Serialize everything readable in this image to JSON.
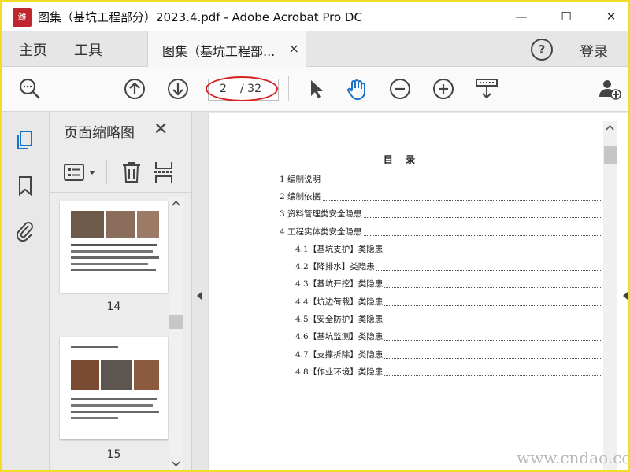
{
  "window": {
    "title": "图集（基坑工程部分）2023.4.pdf - Adobe Acrobat Pro DC",
    "logo_text": "潍",
    "minimize": "—",
    "maximize": "☐",
    "close": "✕"
  },
  "menubar": {
    "home": "主页",
    "tools": "工具",
    "doc_tab": "图集（基坑工程部...",
    "doc_tab_close": "×",
    "help": "?",
    "login": "登录"
  },
  "toolbar": {
    "current_page": "2",
    "total_pages": "/ 32"
  },
  "thumbnail_panel": {
    "title": "页面缩略图",
    "close": "✕",
    "pages": [
      {
        "label": "14"
      },
      {
        "label": "15"
      }
    ]
  },
  "document": {
    "toc_title": "目 录",
    "toc": [
      {
        "text": "1 编制说明",
        "level": 1
      },
      {
        "text": "2 编制依据",
        "level": 1
      },
      {
        "text": "3 资料管理类安全隐患",
        "level": 1
      },
      {
        "text": "4 工程实体类安全隐患",
        "level": 1
      },
      {
        "text": "4.1【基坑支护】类隐患",
        "level": 2
      },
      {
        "text": "4.2【降排水】类隐患",
        "level": 2
      },
      {
        "text": "4.3【基坑开挖】类隐患",
        "level": 2
      },
      {
        "text": "4.4【坑边荷载】类隐患",
        "level": 2
      },
      {
        "text": "4.5【安全防护】类隐患",
        "level": 2
      },
      {
        "text": "4.6【基坑监测】类隐患",
        "level": 2
      },
      {
        "text": "4.7【支撑拆除】类隐患",
        "level": 2
      },
      {
        "text": "4.8【作业环境】类隐患",
        "level": 2
      }
    ],
    "watermark": "www.cndao.com"
  }
}
